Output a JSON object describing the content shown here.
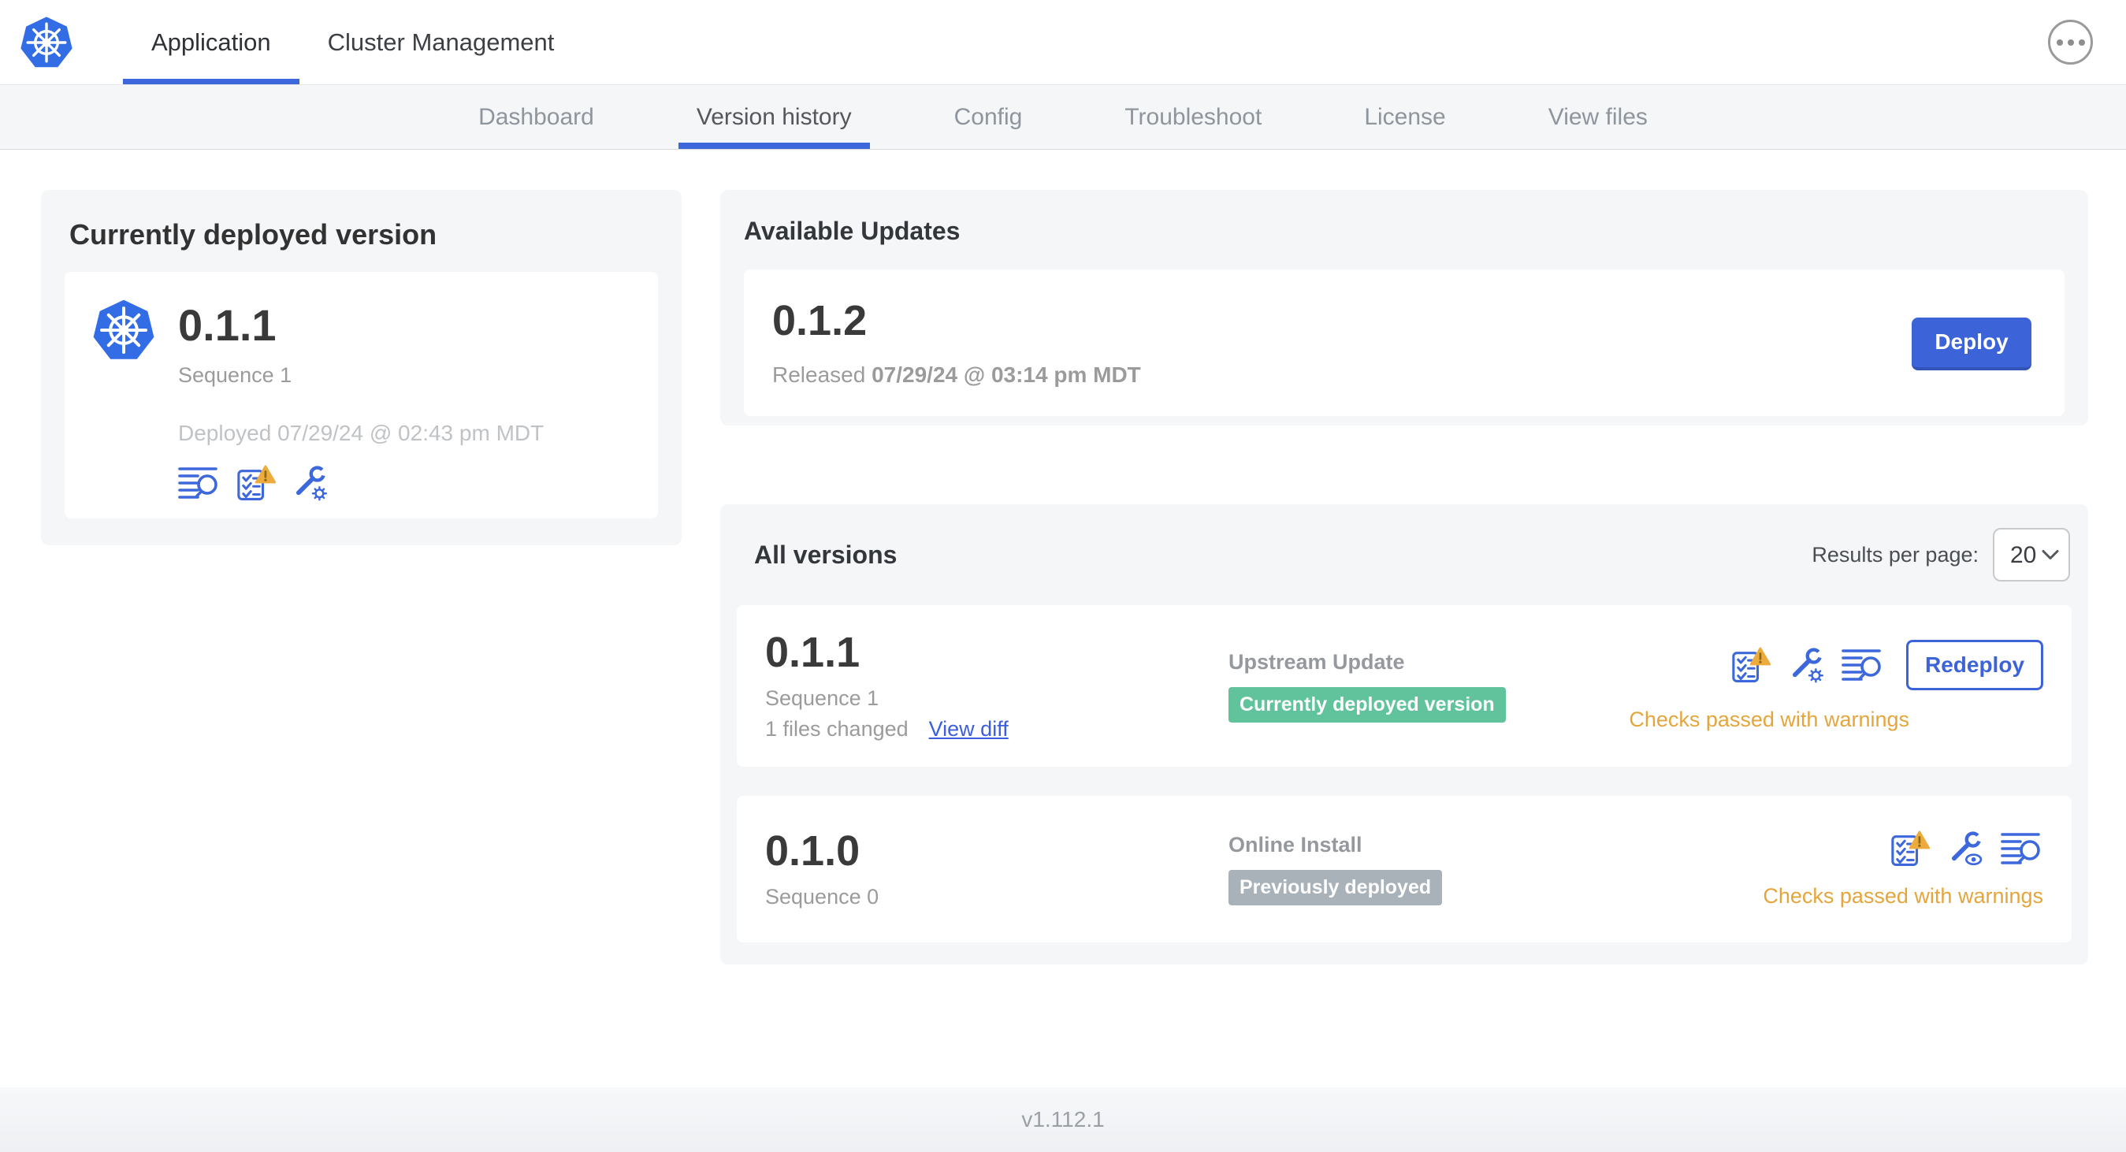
{
  "header": {
    "logo": "kubernetes-logo",
    "tabs": [
      {
        "label": "Application",
        "active": true
      },
      {
        "label": "Cluster Management",
        "active": false
      }
    ],
    "more_button": "ellipsis-menu"
  },
  "subnav": {
    "tabs": [
      {
        "label": "Dashboard",
        "active": false
      },
      {
        "label": "Version history",
        "active": true
      },
      {
        "label": "Config",
        "active": false
      },
      {
        "label": "Troubleshoot",
        "active": false
      },
      {
        "label": "License",
        "active": false
      },
      {
        "label": "View files",
        "active": false
      }
    ]
  },
  "current_version": {
    "title": "Currently deployed version",
    "version": "0.1.1",
    "sequence": "Sequence 1",
    "deployed": "Deployed 07/29/24 @ 02:43 pm MDT",
    "icons": [
      "release-notes-icon",
      "preflight-checks-warning-icon",
      "edit-config-icon"
    ]
  },
  "available_updates": {
    "title": "Available Updates",
    "update": {
      "version": "0.1.2",
      "released_prefix": "Released",
      "released_date": "07/29/24 @ 03:14 pm MDT",
      "deploy_label": "Deploy"
    }
  },
  "all_versions": {
    "title": "All versions",
    "results_per_page_label": "Results per page:",
    "results_per_page_value": "20",
    "rows": [
      {
        "version": "0.1.1",
        "sequence": "Sequence 1",
        "files_changed": "1 files changed",
        "view_diff_label": "View diff",
        "source": "Upstream Update",
        "badge_label": "Currently deployed version",
        "badge_type": "success",
        "icons": [
          "preflight-checks-warning-icon",
          "edit-config-icon",
          "release-notes-icon"
        ],
        "action_label": "Redeploy",
        "preflight_status": "Checks passed with warnings"
      },
      {
        "version": "0.1.0",
        "sequence": "Sequence 0",
        "source": "Online Install",
        "badge_label": "Previously deployed",
        "badge_type": "muted",
        "icons": [
          "preflight-checks-warning-icon",
          "view-config-icon",
          "release-notes-icon"
        ],
        "preflight_status": "Checks passed with warnings"
      }
    ]
  },
  "footer": {
    "app_version": "v1.112.1"
  },
  "colors": {
    "accent_blue": "#3d68dc",
    "logo_blue": "#326de6",
    "success_green": "#61c39b",
    "muted_badge_gray": "#a8b2b8",
    "warning_amber": "#e4a63c",
    "panel_gray": "#f4f6f8"
  }
}
